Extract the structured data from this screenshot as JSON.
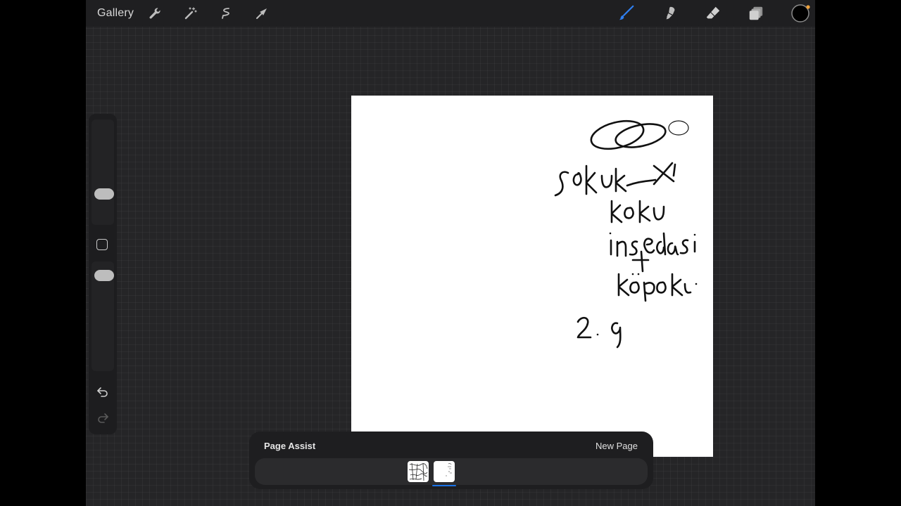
{
  "toolbar": {
    "gallery_label": "Gallery",
    "left_icons": [
      "wrench-icon",
      "magic-wand-icon",
      "selection-icon",
      "transform-arrow-icon"
    ],
    "right_icons": [
      "brush-icon",
      "smudge-icon",
      "eraser-icon",
      "layers-icon",
      "color-swatch-icon"
    ],
    "brush_color": "#2f7ff0",
    "current_color": "#000000",
    "notification_color": "#f0a23a"
  },
  "sidebar": {
    "controls": [
      "brush-size-slider",
      "modify-button",
      "opacity-slider",
      "undo-icon",
      "redo-icon"
    ]
  },
  "page_assist": {
    "title": "Page Assist",
    "new_page_label": "New Page",
    "pages": [
      "page-1",
      "page-2"
    ],
    "active_page": 2,
    "active_color": "#1a73e8"
  }
}
